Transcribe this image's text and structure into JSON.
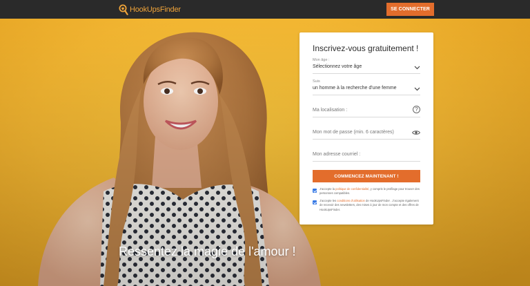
{
  "header": {
    "brand": "HookUpsFinder",
    "login_button": "SE CONNECTER"
  },
  "hero": {
    "caption": "Ressentez la magie de l'amour !"
  },
  "signup": {
    "title": "Inscrivez-vous gratuitement !",
    "age": {
      "label": "Mon âge :",
      "value": "Sélectionnez votre âge"
    },
    "seeking": {
      "label": "Suis",
      "value": "un homme à la recherche d'une femme"
    },
    "location": {
      "placeholder": "Ma localisation :"
    },
    "password": {
      "placeholder": "Mon mot de passe (min. 6 caractères)"
    },
    "email": {
      "placeholder": "Mon adresse courriel :"
    },
    "submit": "COMMENCEZ MAINTENANT !",
    "consent_privacy": {
      "checked": true,
      "before": "J'accepte la ",
      "link": "politique de confidentialité",
      "after": ", y compris le profilage pour trouver des personnes compatibles."
    },
    "consent_terms": {
      "checked": true,
      "before": "J'accepte les ",
      "link": "conditions d'utilisation",
      "after": " de HookUpsFinder . J'accepte également de recevoir des newsletters, des mises à jour de mon compte et des offres de HookUpsFinder."
    }
  },
  "colors": {
    "accent": "#e36d2c",
    "background": "#f2b531",
    "header": "#2a2a2a",
    "checkbox": "#3578e5"
  },
  "icons": {
    "logo": "magnifier-heart-icon",
    "age_dropdown": "chevron-down-icon",
    "seeking_dropdown": "chevron-down-icon",
    "location_help": "question-circle-icon",
    "password_toggle": "eye-icon"
  }
}
